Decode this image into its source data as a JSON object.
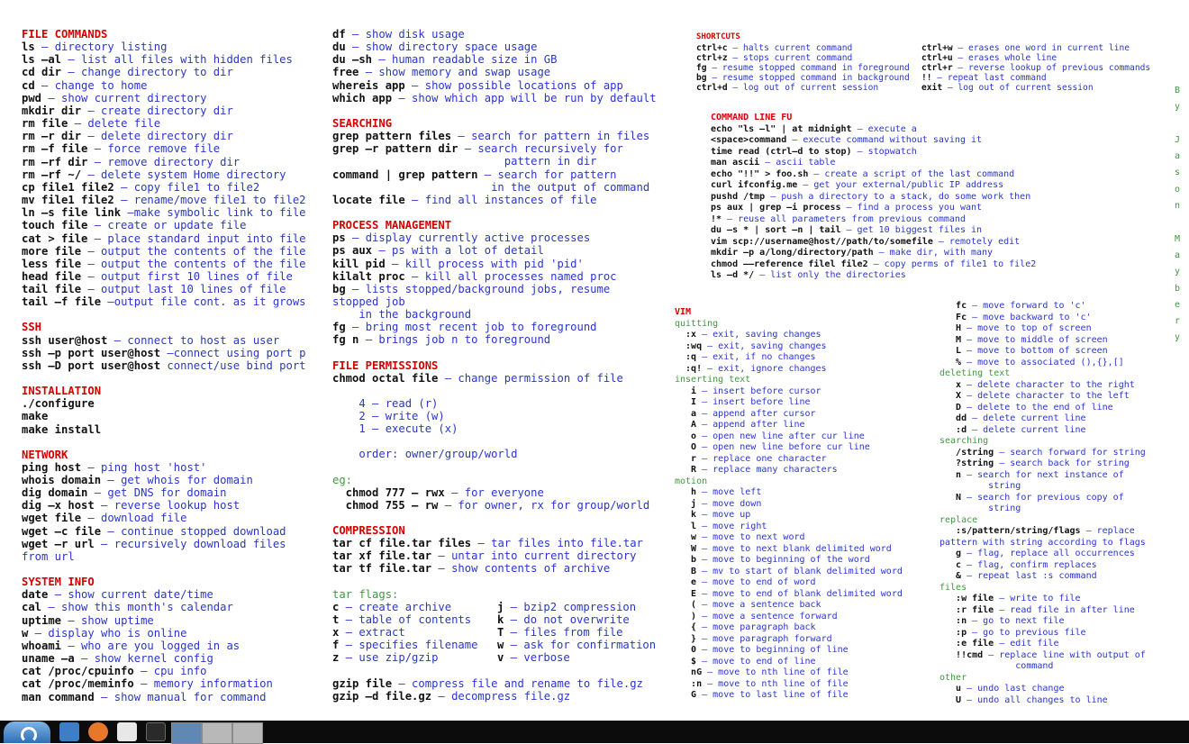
{
  "col1": [
    {
      "t": "h",
      "text": "FILE COMMANDS"
    },
    {
      "t": "r",
      "k": "ls",
      "d": " – directory listing"
    },
    {
      "t": "r",
      "k": "ls –al",
      "d": " – list all files with hidden files"
    },
    {
      "t": "r",
      "k": "cd dir",
      "d": " – change directory to dir"
    },
    {
      "t": "r",
      "k": "cd",
      "d": " – change to home"
    },
    {
      "t": "r",
      "k": "pwd",
      "d": " – show current directory"
    },
    {
      "t": "r",
      "k": "mkdir dir",
      "d": " – create directory dir"
    },
    {
      "t": "r",
      "k": "rm file",
      "d": " – delete file"
    },
    {
      "t": "r",
      "k": "rm –r dir",
      "d": " – delete directory dir"
    },
    {
      "t": "r",
      "k": "rm –f file",
      "d": " – force remove file"
    },
    {
      "t": "r",
      "k": "rm –rf dir",
      "d": " – remove directory dir"
    },
    {
      "t": "r",
      "k": "rm –rf ~/",
      "d": " – delete system Home directory"
    },
    {
      "t": "r",
      "k": "cp file1 file2",
      "d": " – copy file1 to file2"
    },
    {
      "t": "r",
      "k": "mv file1 file2",
      "d": " – rename/move file1 to file2"
    },
    {
      "t": "r",
      "k": "ln –s file link",
      "d": " –make symbolic link to file"
    },
    {
      "t": "r",
      "k": "touch file",
      "d": " – create or update file"
    },
    {
      "t": "r",
      "k": "cat > file",
      "d": " – place standard input into file"
    },
    {
      "t": "r",
      "k": "more file",
      "d": " – output the contents of the file"
    },
    {
      "t": "r",
      "k": "less file",
      "d": " – output the contents of the file"
    },
    {
      "t": "r",
      "k": "head file",
      "d": " – output first 10 lines of file"
    },
    {
      "t": "r",
      "k": "tail file",
      "d": " – output last 10 lines of file"
    },
    {
      "t": "r",
      "k": "tail –f file",
      "d": " –output file cont. as it grows"
    },
    {
      "t": "g"
    },
    {
      "t": "h",
      "text": "SSH"
    },
    {
      "t": "r",
      "k": "ssh user@host",
      "d": " – connect to host as user"
    },
    {
      "t": "r",
      "k": "ssh –p port user@host",
      "d": " –connect using port p"
    },
    {
      "t": "r",
      "k": "ssh –D port user@host",
      "d": " connect/use bind port"
    },
    {
      "t": "g"
    },
    {
      "t": "h",
      "text": "INSTALLATION"
    },
    {
      "t": "r",
      "k": "./configure",
      "d": ""
    },
    {
      "t": "r",
      "k": "make",
      "d": ""
    },
    {
      "t": "r",
      "k": "make install",
      "d": ""
    },
    {
      "t": "g"
    },
    {
      "t": "h",
      "text": "NETWORK"
    },
    {
      "t": "r",
      "k": "ping host",
      "d": " – ping host 'host'"
    },
    {
      "t": "r",
      "k": "whois domain",
      "d": " – get whois for domain"
    },
    {
      "t": "r",
      "k": "dig domain",
      "d": " – get DNS for domain"
    },
    {
      "t": "r",
      "k": "dig –x host",
      "d": " – reverse lookup host"
    },
    {
      "t": "r",
      "k": "wget file",
      "d": " – download file"
    },
    {
      "t": "r",
      "k": "wget –c file",
      "d": " – continue stopped download"
    },
    {
      "t": "r",
      "k": "wget –r url",
      "d": " – recursively download files"
    },
    {
      "t": "r",
      "k": "",
      "d": "from url"
    },
    {
      "t": "g"
    },
    {
      "t": "h",
      "text": "SYSTEM INFO"
    },
    {
      "t": "r",
      "k": "date",
      "d": " – show current date/time"
    },
    {
      "t": "r",
      "k": "cal",
      "d": " – show this month's calendar"
    },
    {
      "t": "r",
      "k": "uptime",
      "d": " – show uptime"
    },
    {
      "t": "r",
      "k": "w",
      "d": " – display who is online"
    },
    {
      "t": "r",
      "k": "whoami",
      "d": " – who are you logged in as"
    },
    {
      "t": "r",
      "k": "uname –a",
      "d": " – show kernel config"
    },
    {
      "t": "r",
      "k": "cat /proc/cpuinfo",
      "d": " – cpu info"
    },
    {
      "t": "r",
      "k": "cat /proc/meminfo",
      "d": " – memory information"
    },
    {
      "t": "r",
      "k": "man command",
      "d": " – show manual for command"
    }
  ],
  "col2": [
    {
      "t": "r",
      "k": "df",
      "d": " – show disk usage"
    },
    {
      "t": "r",
      "k": "du",
      "d": " – show directory space usage"
    },
    {
      "t": "r",
      "k": "du –sh",
      "d": " – human readable size in GB"
    },
    {
      "t": "r",
      "k": "free",
      "d": " – show memory and swap usage"
    },
    {
      "t": "r",
      "k": "whereis app",
      "d": " – show possible locations of app"
    },
    {
      "t": "r",
      "k": "which app",
      "d": " – show which app will be run by default"
    },
    {
      "t": "g"
    },
    {
      "t": "h",
      "text": "SEARCHING"
    },
    {
      "t": "r",
      "k": "grep pattern files",
      "d": " – search for pattern in files"
    },
    {
      "t": "r",
      "k": "grep –r pattern dir",
      "d": " – search recursively for"
    },
    {
      "t": "r",
      "k": "",
      "d": "                          pattern in dir"
    },
    {
      "t": "r",
      "k": "command | grep pattern",
      "d": " – search for pattern"
    },
    {
      "t": "r",
      "k": "",
      "d": "                        in the output of command"
    },
    {
      "t": "r",
      "k": "locate file",
      "d": " – find all instances of file"
    },
    {
      "t": "g"
    },
    {
      "t": "h",
      "text": "PROCESS MANAGEMENT"
    },
    {
      "t": "r",
      "k": "ps",
      "d": " – display currently active processes"
    },
    {
      "t": "r",
      "k": "ps aux",
      "d": " – ps with a lot of detail"
    },
    {
      "t": "r",
      "k": "kill pid",
      "d": " – kill process with pid 'pid'"
    },
    {
      "t": "r",
      "k": "kilalt proc",
      "d": " – kill all processes named proc"
    },
    {
      "t": "r",
      "k": "bg",
      "d": " – lists stopped/background jobs, resume"
    },
    {
      "t": "r",
      "k": "",
      "d": "stopped job"
    },
    {
      "t": "r",
      "k": "",
      "d": "    in the background"
    },
    {
      "t": "r",
      "k": "fg",
      "d": " – bring most recent job to foreground"
    },
    {
      "t": "r",
      "k": "fg n",
      "d": " – brings job n to foreground"
    },
    {
      "t": "g"
    },
    {
      "t": "h",
      "text": "FILE PERMISSIONS"
    },
    {
      "t": "r",
      "k": "chmod octal file",
      "d": " – change permission of file"
    },
    {
      "t": "g"
    },
    {
      "t": "r",
      "k": "",
      "d": "    4 – read (r)"
    },
    {
      "t": "r",
      "k": "",
      "d": "    2 – write (w)"
    },
    {
      "t": "r",
      "k": "",
      "d": "    1 – execute (x)"
    },
    {
      "t": "g"
    },
    {
      "t": "r",
      "k": "",
      "d": "    order: owner/group/world"
    },
    {
      "t": "g"
    },
    {
      "t": "s",
      "text": "  eg:"
    },
    {
      "t": "r",
      "k": "  chmod 777 – rwx",
      "d": " – for everyone"
    },
    {
      "t": "r",
      "k": "  chmod 755 – rw",
      "d": " – for owner, rx for group/world"
    },
    {
      "t": "g"
    },
    {
      "t": "h",
      "text": "COMPRESSION"
    },
    {
      "t": "r",
      "k": "tar cf file.tar files",
      "d": " – tar files into file.tar"
    },
    {
      "t": "r",
      "k": "tar xf file.tar",
      "d": " – untar into current directory"
    },
    {
      "t": "r",
      "k": "tar tf file.tar",
      "d": " – show contents of archive"
    },
    {
      "t": "g"
    },
    {
      "t": "s",
      "text": "tar flags:"
    },
    {
      "t": "r2",
      "k1": "c",
      "d1": " – create archive",
      "k2": "j",
      "d2": " – bzip2 compression"
    },
    {
      "t": "r2",
      "k1": "t",
      "d1": " – table of contents",
      "k2": "k",
      "d2": " – do not overwrite"
    },
    {
      "t": "r2",
      "k1": "x",
      "d1": " – extract",
      "k2": "T",
      "d2": " – files from file"
    },
    {
      "t": "r2",
      "k1": "f",
      "d1": " – specifies filename",
      "k2": "w",
      "d2": " – ask for confirmation"
    },
    {
      "t": "r2",
      "k1": "z",
      "d1": " – use zip/gzip",
      "k2": "v",
      "d2": " – verbose"
    },
    {
      "t": "g"
    },
    {
      "t": "r",
      "k": "gzip file",
      "d": " – compress file and rename to file.gz"
    },
    {
      "t": "r",
      "k": "gzip –d file.gz",
      "d": " – decompress file.gz"
    }
  ],
  "shortcuts": {
    "title": "SHORTCUTS",
    "left": [
      {
        "k": "ctrl+c",
        "d": " – halts current command"
      },
      {
        "k": "ctrl+z",
        "d": " – stops current command"
      },
      {
        "k": "fg",
        "d": " – resume stopped command in foreground"
      },
      {
        "k": "bg",
        "d": " – resume stopped command in background"
      },
      {
        "k": "ctrl+d",
        "d": " – log out of current session"
      }
    ],
    "right": [
      {
        "k": "ctrl+w",
        "d": " – erases one word in current line"
      },
      {
        "k": "ctrl+u",
        "d": " – erases whole line"
      },
      {
        "k": "ctrl+r",
        "d": " – reverse lookup of previous commands"
      },
      {
        "k": "!!",
        "d": " – repeat last command"
      },
      {
        "k": "exit",
        "d": " – log out of current session"
      }
    ]
  },
  "cmdfu": [
    {
      "t": "h",
      "text": "COMMAND LINE FU"
    },
    {
      "t": "r",
      "k": "echo \"ls –l\" | at midnight",
      "d": " – execute a"
    },
    {
      "t": "r",
      "k": "<space>command",
      "d": " – execute command without saving it"
    },
    {
      "t": "r",
      "k": "time read (ctrl–d to stop)",
      "d": " – stopwatch"
    },
    {
      "t": "r",
      "k": "man ascii",
      "d": " – ascii table"
    },
    {
      "t": "r",
      "k": "echo \"!!\" > foo.sh",
      "d": " – create a script of the last command"
    },
    {
      "t": "r",
      "k": "curl ifconfig.me",
      "d": " – get your external/public IP address"
    },
    {
      "t": "r",
      "k": "pushd /tmp",
      "d": " – push a directory to a stack, do some work then"
    },
    {
      "t": "r",
      "k": "ps aux | grep –i process",
      "d": " – find a process you want"
    },
    {
      "t": "r",
      "k": "!*",
      "d": " – reuse all parameters from previous command"
    },
    {
      "t": "r",
      "k": "du –s * | sort –n | tail",
      "d": " – get 10 biggest files in"
    },
    {
      "t": "r",
      "k": "vim scp://username@host//path/to/somefile",
      "d": " – remotely edit"
    },
    {
      "t": "r",
      "k": "mkdir –p a/long/directory/path",
      "d": " – make dir, with many"
    },
    {
      "t": "r",
      "k": "chmod ––reference filel file2",
      "d": " – copy perms of file1 to file2"
    },
    {
      "t": "r",
      "k": "ls –d */",
      "d": " – list only the directories"
    }
  ],
  "vim1": [
    {
      "t": "h",
      "text": "VIM"
    },
    {
      "t": "s",
      "text": "quitting"
    },
    {
      "t": "r",
      "k": "  :x",
      "d": " – exit, saving changes"
    },
    {
      "t": "r",
      "k": "  :wq",
      "d": " – exit, saving changes"
    },
    {
      "t": "r",
      "k": "  :q",
      "d": " – exit, if no changes"
    },
    {
      "t": "r",
      "k": "  :q!",
      "d": " – exit, ignore changes"
    },
    {
      "t": "s",
      "text": "inserting text"
    },
    {
      "t": "r",
      "k": "   i",
      "d": " – insert before cursor"
    },
    {
      "t": "r",
      "k": "   I",
      "d": " – insert before line"
    },
    {
      "t": "r",
      "k": "   a",
      "d": " – append after cursor"
    },
    {
      "t": "r",
      "k": "   A",
      "d": " – append after line"
    },
    {
      "t": "r",
      "k": "   o",
      "d": " – open new line after cur line"
    },
    {
      "t": "r",
      "k": "   O",
      "d": " – open new line before cur line"
    },
    {
      "t": "r",
      "k": "   r",
      "d": " – replace one character"
    },
    {
      "t": "r",
      "k": "   R",
      "d": " – replace many characters"
    },
    {
      "t": "s",
      "text": "motion"
    },
    {
      "t": "r",
      "k": "   h",
      "d": " – move left"
    },
    {
      "t": "r",
      "k": "   j",
      "d": " – move down"
    },
    {
      "t": "r",
      "k": "   k",
      "d": " – move up"
    },
    {
      "t": "r",
      "k": "   l",
      "d": " – move right"
    },
    {
      "t": "r",
      "k": "   w",
      "d": " – move to next word"
    },
    {
      "t": "r",
      "k": "   W",
      "d": " – move to next blank delimited word"
    },
    {
      "t": "r",
      "k": "   b",
      "d": " – move to beginning of the word"
    },
    {
      "t": "r",
      "k": "   B",
      "d": " – mv to start of blank delimited word"
    },
    {
      "t": "r",
      "k": "   e",
      "d": " – move to end of word"
    },
    {
      "t": "r",
      "k": "   E",
      "d": " – move to end of blank delimited word"
    },
    {
      "t": "r",
      "k": "   (",
      "d": " – move a sentence back"
    },
    {
      "t": "r",
      "k": "   )",
      "d": " – move a sentence forward"
    },
    {
      "t": "r",
      "k": "   {",
      "d": " – move paragraph back"
    },
    {
      "t": "r",
      "k": "   }",
      "d": " – move paragraph forward"
    },
    {
      "t": "r",
      "k": "   0",
      "d": " – move to beginning of line"
    },
    {
      "t": "r",
      "k": "   $",
      "d": " – move to end of line"
    },
    {
      "t": "r",
      "k": "   nG",
      "d": " – move to nth line of file"
    },
    {
      "t": "r",
      "k": "   :n",
      "d": " – move to nth line of file"
    },
    {
      "t": "r",
      "k": "   G",
      "d": " – move to last line of file"
    }
  ],
  "vim2": [
    {
      "t": "r",
      "k": "   fc",
      "d": " – move forward to 'c'"
    },
    {
      "t": "r",
      "k": "   Fc",
      "d": " – move backward to 'c'"
    },
    {
      "t": "r",
      "k": "   H",
      "d": " – move to top of screen"
    },
    {
      "t": "r",
      "k": "   M",
      "d": " – move to middle of screen"
    },
    {
      "t": "r",
      "k": "   L",
      "d": " – move to bottom of screen"
    },
    {
      "t": "r",
      "k": "   %",
      "d": " – move to associated (),{},[]"
    },
    {
      "t": "s",
      "text": "deleting text"
    },
    {
      "t": "r",
      "k": "   x",
      "d": " – delete character to the right"
    },
    {
      "t": "r",
      "k": "   X",
      "d": " – delete character to the left"
    },
    {
      "t": "r",
      "k": "   D",
      "d": " – delete to the end of line"
    },
    {
      "t": "r",
      "k": "   dd",
      "d": " – delete current line"
    },
    {
      "t": "r",
      "k": "   :d",
      "d": " – delete current line"
    },
    {
      "t": "s",
      "text": "searching"
    },
    {
      "t": "r",
      "k": "   /string",
      "d": " – search forward for string"
    },
    {
      "t": "r",
      "k": "   ?string",
      "d": " – search back for string"
    },
    {
      "t": "r",
      "k": "   n",
      "d": " – search for next instance of"
    },
    {
      "t": "r",
      "k": "",
      "d": "         string"
    },
    {
      "t": "r",
      "k": "   N",
      "d": " – search for previous copy of"
    },
    {
      "t": "r",
      "k": "",
      "d": "         string"
    },
    {
      "t": "s",
      "text": "replace"
    },
    {
      "t": "r",
      "k": "   :s/pattern/string/flags",
      "d": " – replace"
    },
    {
      "t": "r",
      "k": "",
      "d": "pattern with string according to flags"
    },
    {
      "t": "r",
      "k": "   g",
      "d": " – flag, replace all occurrences"
    },
    {
      "t": "r",
      "k": "   c",
      "d": " – flag, confirm replaces"
    },
    {
      "t": "r",
      "k": "   &",
      "d": " – repeat last :s command"
    },
    {
      "t": "s",
      "text": "files"
    },
    {
      "t": "r",
      "k": "   :w file",
      "d": " – write to file"
    },
    {
      "t": "r",
      "k": "   :r file",
      "d": " – read file in after line"
    },
    {
      "t": "r",
      "k": "   :n",
      "d": " – go to next file"
    },
    {
      "t": "r",
      "k": "   :p",
      "d": " – go to previous file"
    },
    {
      "t": "r",
      "k": "   :e file",
      "d": " – edit file"
    },
    {
      "t": "r",
      "k": "   !!cmd",
      "d": " – replace line with output of"
    },
    {
      "t": "r",
      "k": "",
      "d": "              command"
    },
    {
      "t": "s",
      "text": "other"
    },
    {
      "t": "r",
      "k": "   u",
      "d": " – undo last change"
    },
    {
      "t": "r",
      "k": "   U",
      "d": " – undo all changes to line"
    }
  ],
  "author": "By Jason Maybery",
  "author_letters": [
    "B",
    "y",
    "",
    "J",
    "a",
    "s",
    "o",
    "n",
    "",
    "M",
    "a",
    "y",
    "b",
    "e",
    "r",
    "y"
  ],
  "taskbar": {
    "icons": [
      {
        "name": "folder-icon",
        "color": "#3d7fc7"
      },
      {
        "name": "firefox-icon",
        "color": "#e8772e"
      },
      {
        "name": "text-editor-icon",
        "color": "#e8e8e8"
      },
      {
        "name": "terminal-icon",
        "color": "#2a2a2a"
      }
    ]
  },
  "colors": {
    "heading": "#d40000",
    "command": "#111111",
    "description": "#2a36c8",
    "subheading": "#3d9a3d",
    "taskbar": "#0c0c0c"
  }
}
